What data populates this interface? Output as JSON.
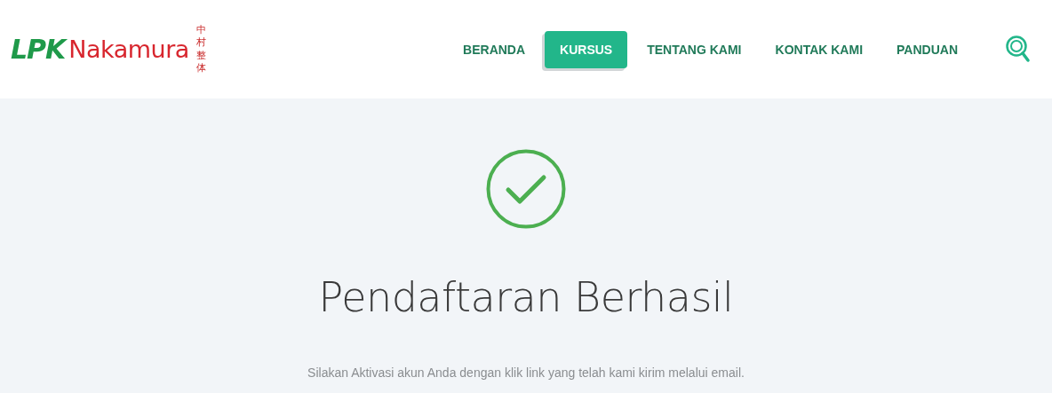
{
  "logo": {
    "prefix": "LPK",
    "name": "Nakamura",
    "vertical": "中村整体"
  },
  "nav": [
    {
      "label": "BERANDA",
      "selected": false
    },
    {
      "label": "KURSUS",
      "selected": true
    },
    {
      "label": "TENTANG KAMI",
      "selected": false
    },
    {
      "label": "KONTAK KAMI",
      "selected": false
    },
    {
      "label": "PANDUAN",
      "selected": false
    }
  ],
  "title": "Pendaftaran Berhasil",
  "message": "Silakan Aktivasi akun Anda dengan klik link yang telah kami kirim melalui email."
}
